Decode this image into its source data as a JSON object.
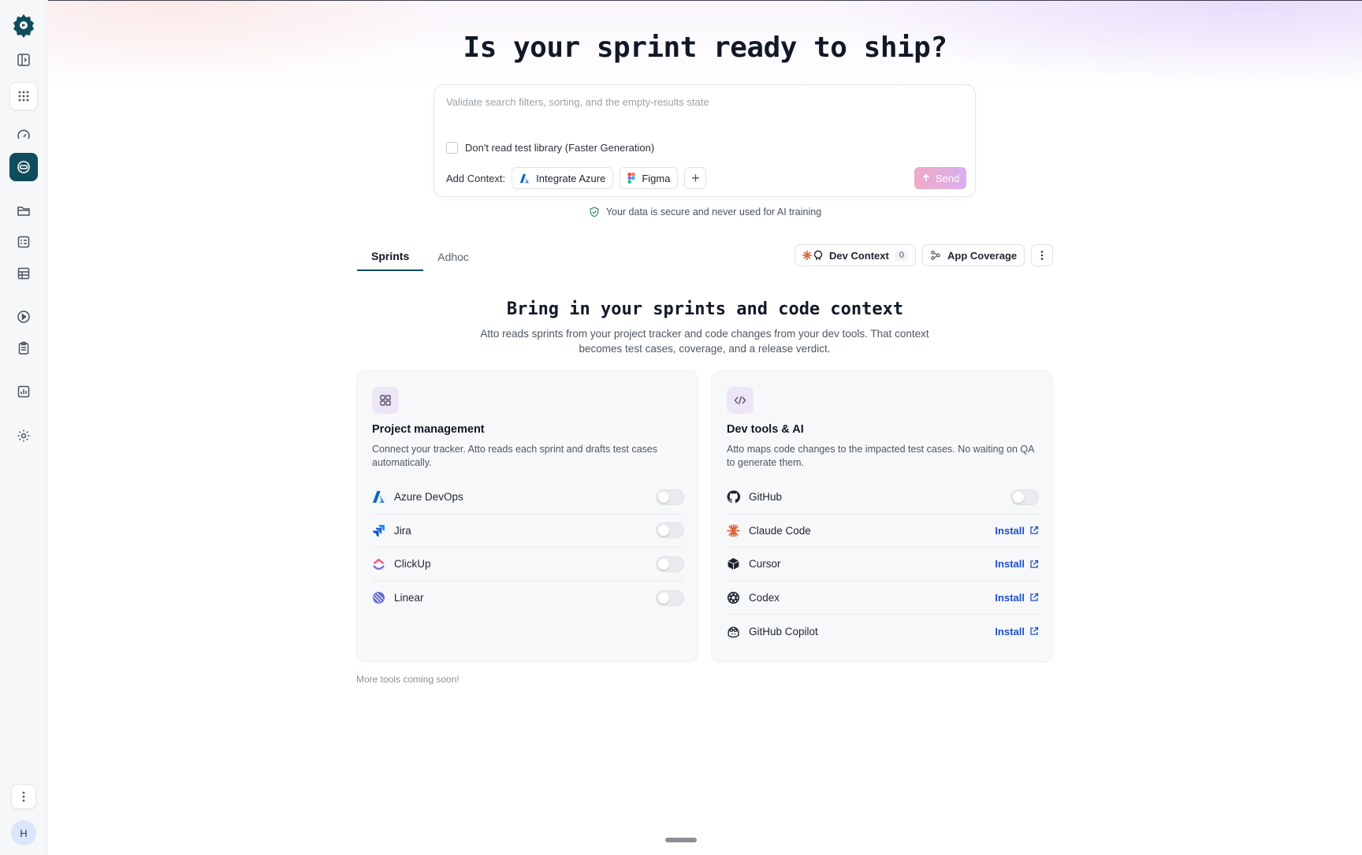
{
  "hero": {
    "title": "Is your sprint ready to ship?"
  },
  "prompt": {
    "placeholder": "Validate search filters, sorting, and the empty-results state",
    "checkbox_label": "Don't read test library (Faster Generation)",
    "context_label": "Add Context:",
    "chips": [
      "Integrate Azure",
      "Figma"
    ],
    "send_label": "Send"
  },
  "secure_note": "Your data is secure and never used for AI training",
  "tabs": [
    {
      "label": "Sprints",
      "active": true
    },
    {
      "label": "Adhoc",
      "active": false
    }
  ],
  "actions": {
    "dev_context_label": "Dev Context",
    "dev_context_count": "0",
    "app_coverage_label": "App Coverage"
  },
  "intro": {
    "title": "Bring in your sprints and code context",
    "subtitle": "Atto reads sprints from your project tracker and code changes from your dev tools. That context becomes test cases, coverage, and a release verdict."
  },
  "cards": {
    "pm": {
      "title": "Project management",
      "description": "Connect your tracker. Atto reads each sprint and drafts test cases automatically.",
      "items": [
        {
          "name": "Azure DevOps",
          "icon": "azure-devops-icon"
        },
        {
          "name": "Jira",
          "icon": "jira-icon"
        },
        {
          "name": "ClickUp",
          "icon": "clickup-icon"
        },
        {
          "name": "Linear",
          "icon": "linear-icon"
        }
      ]
    },
    "dev": {
      "title": "Dev tools & AI",
      "description": "Atto maps code changes to the impacted test cases. No waiting on QA to generate them.",
      "items": [
        {
          "name": "GitHub",
          "icon": "github-icon",
          "action": ""
        },
        {
          "name": "Claude Code",
          "icon": "claude-icon",
          "action": "Install"
        },
        {
          "name": "Cursor",
          "icon": "cursor-icon",
          "action": "Install"
        },
        {
          "name": "Codex",
          "icon": "codex-icon",
          "action": "Install"
        },
        {
          "name": "GitHub Copilot",
          "icon": "copilot-icon",
          "action": "Install"
        }
      ]
    }
  },
  "footer_note": "More tools coming soon!",
  "user": {
    "initial": "H"
  },
  "colors": {
    "accent": "#0f4c5c",
    "link": "#1e4fc4",
    "send_from": "#f2a9c6",
    "send_to": "#d9aef0"
  }
}
